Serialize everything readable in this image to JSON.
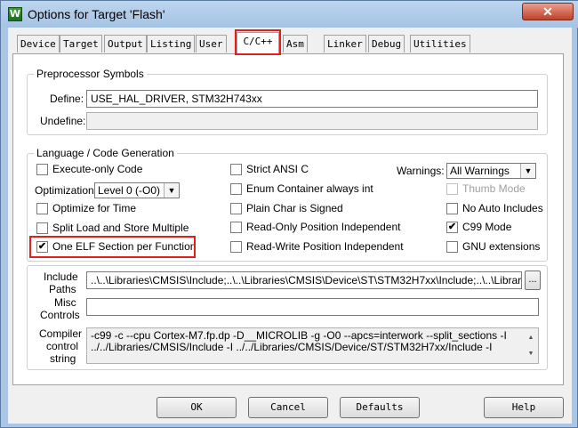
{
  "window": {
    "title": "Options for Target 'Flash'",
    "close_label": "✕",
    "app_icon_letter": "W"
  },
  "tabs": [
    "Device",
    "Target",
    "Output",
    "Listing",
    "User",
    "C/C++",
    "Asm",
    "Linker",
    "Debug",
    "Utilities"
  ],
  "active_tab": "C/C++",
  "preprocessor": {
    "legend": "Preprocessor Symbols",
    "define_label": "Define:",
    "define_value": "USE_HAL_DRIVER, STM32H743xx",
    "undefine_label": "Undefine:",
    "undefine_value": ""
  },
  "language": {
    "legend": "Language / Code Generation",
    "execute_only": {
      "label": "Execute-only Code",
      "checked": false
    },
    "optimization_label": "Optimization:",
    "optimization_value": "Level 0 (-O0)",
    "optimize_for_time": {
      "label": "Optimize for Time",
      "checked": false
    },
    "split_load_store": {
      "label": "Split Load and Store Multiple",
      "checked": false
    },
    "one_elf_section": {
      "label": "One ELF Section per Function",
      "checked": true
    },
    "strict_ansi": {
      "label": "Strict ANSI C",
      "checked": false
    },
    "enum_container": {
      "label": "Enum Container always int",
      "checked": false
    },
    "plain_char": {
      "label": "Plain Char is Signed",
      "checked": false
    },
    "ro_position": {
      "label": "Read-Only Position Independent",
      "checked": false
    },
    "rw_position": {
      "label": "Read-Write Position Independent",
      "checked": false
    },
    "warnings_label": "Warnings:",
    "warnings_value": "All Warnings",
    "thumb_mode": {
      "label": "Thumb Mode",
      "checked": false,
      "disabled": true
    },
    "no_auto_includes": {
      "label": "No Auto Includes",
      "checked": false
    },
    "c99_mode": {
      "label": "C99 Mode",
      "checked": true
    },
    "gnu_extensions": {
      "label": "GNU extensions",
      "checked": false
    }
  },
  "include_paths": {
    "label_line1": "Include",
    "label_line2": "Paths",
    "value": "..\\..\\Libraries\\CMSIS\\Include;..\\..\\Libraries\\CMSIS\\Device\\ST\\STM32H7xx\\Include;..\\..\\Libraries\\S",
    "browse_label": "..."
  },
  "misc_controls": {
    "label_line1": "Misc",
    "label_line2": "Controls",
    "value": ""
  },
  "compiler_control": {
    "label_line1": "Compiler",
    "label_line2": "control",
    "label_line3": "string",
    "line1": "-c99 -c --cpu Cortex-M7.fp.dp -D__MICROLIB -g -O0 --apcs=interwork --split_sections -I",
    "line2": "../../Libraries/CMSIS/Include -I ../../Libraries/CMSIS/Device/ST/STM32H7xx/Include -I",
    "scroll_up": "▲",
    "scroll_down": "▼"
  },
  "buttons": {
    "ok": "OK",
    "cancel": "Cancel",
    "defaults": "Defaults",
    "help": "Help"
  },
  "colors": {
    "highlight": "#e02020",
    "titlebar": "#a6c3e4"
  }
}
